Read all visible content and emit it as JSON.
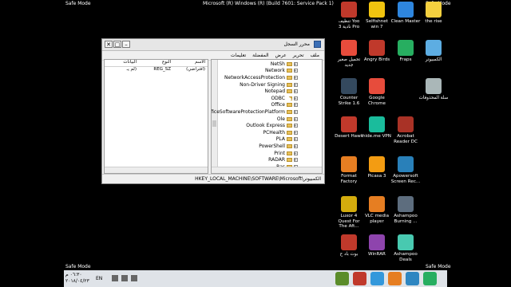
{
  "overlay": {
    "safe_mode": "Safe Mode",
    "build": "Microsoft (R) Windows (R) (Build 7601: Service Pack 1)"
  },
  "regedit": {
    "title": "محرر السجل",
    "menu": [
      "ملف",
      "تحرير",
      "عرض",
      "المفضلة",
      "تعليمات"
    ],
    "columns": [
      "الاسم",
      "النوع",
      "البيانات"
    ],
    "value_row": [
      "(افتراضي)",
      "REG_SZ",
      "(لم يـ"
    ],
    "tree_items": [
      "NetSh",
      "Network",
      "NetworkAccessProtection",
      "Non-Driver Signing",
      "Notepad",
      "ODBC",
      "Office",
      "ficeSoftwareProtectionPlatform",
      "Ole",
      "Outlook Express",
      "PCHealth",
      "PLA",
      "PowerShell",
      "Print",
      "RADAR",
      "Ras"
    ],
    "status": "HKEY_LOCAL_MACHINE\\SOFTWARE\\Microsoft\\الكمبيوتر"
  },
  "desktop_icons": [
    {
      "label": "تنظيف Yoo\nنادية 3 Pro",
      "color": "#c0392b"
    },
    {
      "label": "Selfishnet win 7",
      "color": "#f1c40f"
    },
    {
      "label": "Clean Master",
      "color": "#2e86de"
    },
    {
      "label": "the rise",
      "color": "#f4d03f"
    },
    {
      "label": "تحميل صغير\nجديد",
      "color": "#e74c3c"
    },
    {
      "label": "Angry Birds",
      "color": "#c0392b"
    },
    {
      "label": "Fraps",
      "color": "#27ae60"
    },
    {
      "label": "الكمبيوتر",
      "color": "#5dade2"
    },
    {
      "label": "Counter Strike 1.6",
      "color": "#34495e"
    },
    {
      "label": "Google Chrome",
      "color": "#e74c3c"
    },
    {
      "label": "سلة المحذوفات",
      "color": "#aab7b8"
    },
    {
      "label": "Desert Hawk",
      "color": "#c0392b"
    },
    {
      "label": "hide.me VPN",
      "color": "#1abc9c"
    },
    {
      "label": "Acrobat Reader DC",
      "color": "#a93226"
    },
    {
      "label": "Format Factory",
      "color": "#e67e22"
    },
    {
      "label": "Picasa 3",
      "color": "#f39c12"
    },
    {
      "label": "Apowersoft Screen Rec...",
      "color": "#2980b9"
    },
    {
      "label": "Luxor 4 Quest For The Aft...",
      "color": "#d4ac0d"
    },
    {
      "label": "VLC media player",
      "color": "#e67e22"
    },
    {
      "label": "Ashampoo Burning ...",
      "color": "#5d6d7e"
    },
    {
      "label": "بوت باد ح",
      "color": "#c0392b"
    },
    {
      "label": "WinRAR",
      "color": "#8e44ad"
    },
    {
      "label": "Ashampoo Deals",
      "color": "#48c9b0"
    }
  ],
  "taskbar": {
    "clock": "٠٦:٣٠ م",
    "date": "٢٠١٨/٠٤/٢٣",
    "lang": "EN",
    "apps": [
      {
        "name": "minecraft-app",
        "color": "#5b8c2a"
      },
      {
        "name": "app-2",
        "color": "#c0392b"
      },
      {
        "name": "chrome-app",
        "color": "#3498db"
      },
      {
        "name": "app-4",
        "color": "#e67e22"
      },
      {
        "name": "app-5",
        "color": "#2e86c1"
      },
      {
        "name": "app-6",
        "color": "#27ae60"
      }
    ]
  }
}
